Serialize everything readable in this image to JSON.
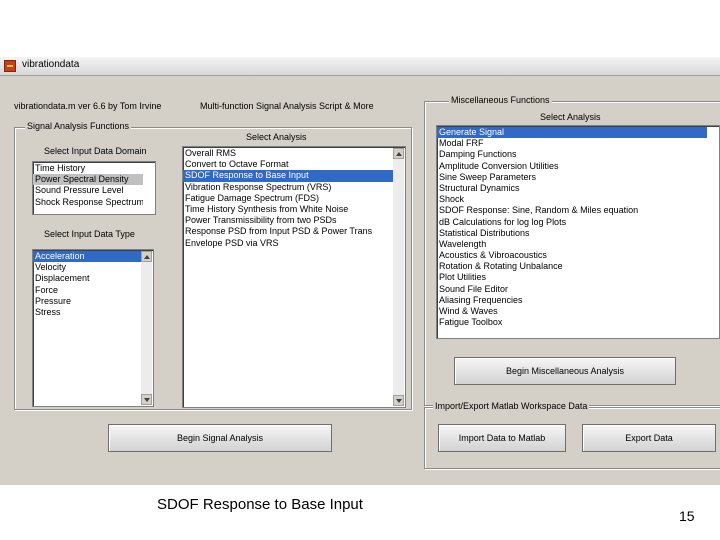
{
  "window": {
    "title": "vibrationdata",
    "header_left": "vibrationdata.m   ver 6.6   by Tom Irvine",
    "header_right": "Multi-function Signal Analysis Script & More"
  },
  "signal_panel": {
    "title": "Signal Analysis Functions",
    "domain_label": "Select Input Data Domain",
    "domain_items": [
      "Time History",
      "Power Spectral Density",
      "Sound Pressure Level",
      "Shock Response Spectrum"
    ],
    "datatype_label": "Select Input Data Type",
    "datatype_items": [
      "Acceleration",
      "Velocity",
      "Displacement",
      "Force",
      "Pressure",
      "Stress"
    ],
    "analysis_label": "Select Analysis",
    "analysis_items": [
      "Overall RMS",
      "Convert to Octave Format",
      "SDOF Response to Base Input",
      "Vibration Response Spectrum (VRS)",
      "Fatigue Damage Spectrum (FDS)",
      "Time History Synthesis from White Noise",
      "Power Transmissibility from two PSDs",
      "Response PSD from Input PSD & Power Trans",
      "Envelope PSD via VRS"
    ],
    "begin_button": "Begin Signal Analysis"
  },
  "misc_panel": {
    "title": "Miscellaneous Functions",
    "analysis_label": "Select Analysis",
    "items": [
      "Generate Signal",
      "Modal FRF",
      "Damping Functions",
      "Amplitude Conversion Utilities",
      "Sine Sweep Parameters",
      "Structural Dynamics",
      "Shock",
      "SDOF Response: Sine, Random & Miles equation",
      "dB Calculations for log log Plots",
      "Statistical Distributions",
      "Wavelength",
      "Acoustics & Vibroacoustics",
      "Rotation & Rotating Unbalance",
      "Plot Utilities",
      "Sound File Editor",
      "Aliasing Frequencies",
      "Wind & Waves",
      "Fatigue Toolbox"
    ],
    "begin_button": "Begin Miscellaneous Analysis"
  },
  "import_panel": {
    "title": "Import/Export Matlab Workspace Data",
    "import_button": "Import Data to Matlab",
    "export_button": "Export Data"
  },
  "slide": {
    "caption": "SDOF Response to Base Input",
    "page_number": "15"
  },
  "colors": {
    "selection": "#3169c6",
    "window_bg": "#d4d0c8"
  },
  "selection": {
    "domain_selected": 1,
    "datatype_selected": 0,
    "analysis_selected": 2,
    "misc_selected": 0
  }
}
